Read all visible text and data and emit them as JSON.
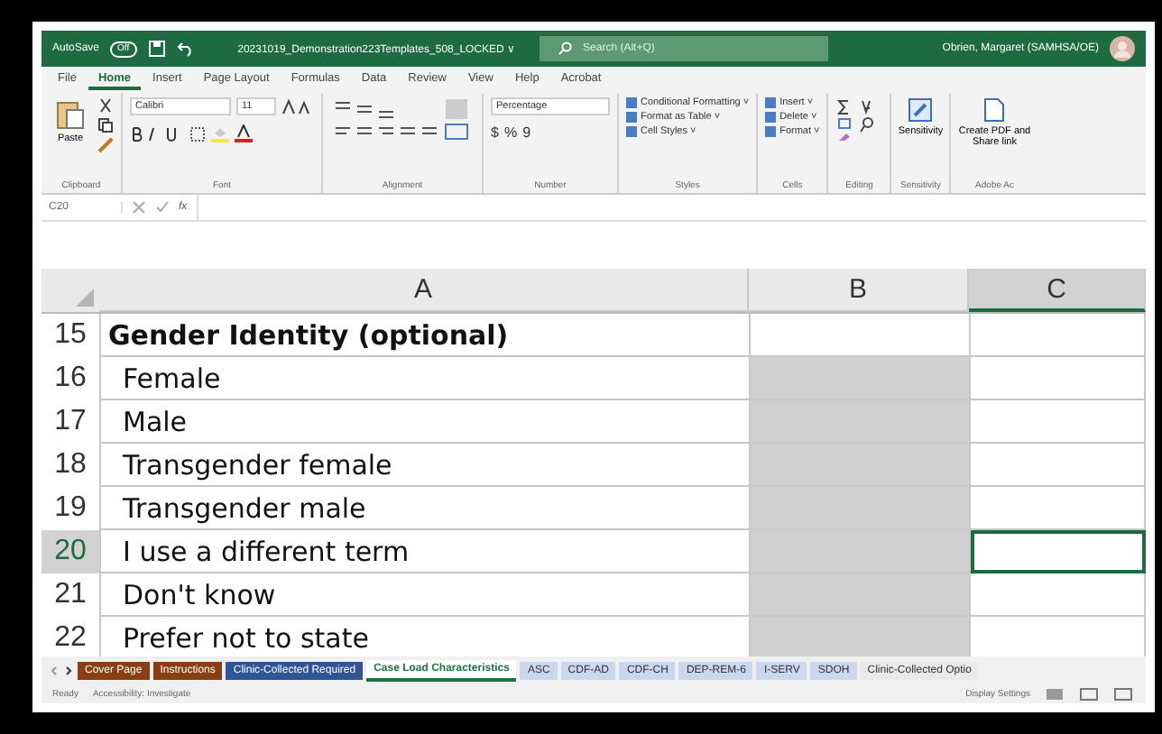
{
  "title_bar": {
    "autosave_label": "AutoSave",
    "autosave_on": false,
    "autosave_state": "Off",
    "filename": "20231019_Demonstration223Templates_508_LOCKED ∨",
    "search": {
      "placeholder": "Search (Alt+Q)"
    },
    "user": "Obrien, Margaret (SAMHSA/OE)"
  },
  "ribbon_tabs": [
    {
      "label": "File",
      "selected": false
    },
    {
      "label": "Home",
      "selected": true
    },
    {
      "label": "Insert",
      "selected": false
    },
    {
      "label": "Page Layout",
      "selected": false
    },
    {
      "label": "Formulas",
      "selected": false
    },
    {
      "label": "Data",
      "selected": false
    },
    {
      "label": "Review",
      "selected": false
    },
    {
      "label": "View",
      "selected": false
    },
    {
      "label": "Help",
      "selected": false
    },
    {
      "label": "Acrobat",
      "selected": false
    }
  ],
  "ribbon": {
    "clipboard": {
      "paste": "Paste",
      "label": "Clipboard"
    },
    "font": {
      "name": "Calibri",
      "size": "11",
      "label": "Font"
    },
    "alignment": {
      "label": "Alignment"
    },
    "number": {
      "format": "Percentage",
      "currency": "$",
      "percent": "%",
      "comma": "9",
      "label": "Number"
    },
    "styles": {
      "items": [
        "Conditional Formatting ˅",
        "Format as Table ˅",
        "Cell Styles ˅"
      ],
      "label": "Styles"
    },
    "cells": {
      "items": [
        "Insert ˅",
        "Delete ˅",
        "Format ˅"
      ],
      "label": "Cells"
    },
    "editing": {
      "label": "Editing"
    },
    "sensitivity": {
      "button": "Sensitivity",
      "label": "Sensitivity"
    },
    "adobe": {
      "button": "Create PDF and Share link",
      "label": "Adobe Ac"
    }
  },
  "formula_bar": {
    "name_box": "C20",
    "fx": "fx"
  },
  "columns": [
    {
      "label": "A",
      "selected": false
    },
    {
      "label": "B",
      "selected": false
    },
    {
      "label": "C",
      "selected": true
    }
  ],
  "rows": [
    {
      "number": "15",
      "text": "Gender Identity (optional)",
      "bold": true,
      "b_shaded": false,
      "selected": false
    },
    {
      "number": "16",
      "text": "Female",
      "bold": false,
      "b_shaded": true,
      "selected": false
    },
    {
      "number": "17",
      "text": "Male",
      "bold": false,
      "b_shaded": true,
      "selected": false
    },
    {
      "number": "18",
      "text": "Transgender female",
      "bold": false,
      "b_shaded": true,
      "selected": false
    },
    {
      "number": "19",
      "text": "Transgender male",
      "bold": false,
      "b_shaded": true,
      "selected": false
    },
    {
      "number": "20",
      "text": "I use a different term",
      "bold": false,
      "b_shaded": true,
      "selected": true
    },
    {
      "number": "21",
      "text": "Don't know",
      "bold": false,
      "b_shaded": true,
      "selected": false
    },
    {
      "number": "22",
      "text": "Prefer not to state",
      "bold": false,
      "b_shaded": true,
      "selected": false
    }
  ],
  "sheet_tabs": [
    {
      "label": "Cover Page",
      "color": "#8a3f12",
      "selected": false
    },
    {
      "label": "Instructions",
      "color": "#8a3f12",
      "selected": false
    },
    {
      "label": "Clinic-Collected Required",
      "color": "#2f5597",
      "selected": false
    },
    {
      "label": "Case Load Characteristics",
      "color": "#1e7145",
      "selected": true
    },
    {
      "label": "ASC",
      "color": "#c9d7ef",
      "selected": false
    },
    {
      "label": "CDF-AD",
      "color": "#c9d7ef",
      "selected": false
    },
    {
      "label": "CDF-CH",
      "color": "#c9d7ef",
      "selected": false
    },
    {
      "label": "DEP-REM-6",
      "color": "#c9d7ef",
      "selected": false
    },
    {
      "label": "I-SERV",
      "color": "#c9d7ef",
      "selected": false
    },
    {
      "label": "SDOH",
      "color": "#c9d7ef",
      "selected": false
    },
    {
      "label": "Clinic-Collected Optio",
      "color": "#e9e9e9",
      "selected": false
    }
  ],
  "status_bar": {
    "state": "Ready",
    "accessibility": "Accessibility: Investigate",
    "display": "Display Settings"
  }
}
